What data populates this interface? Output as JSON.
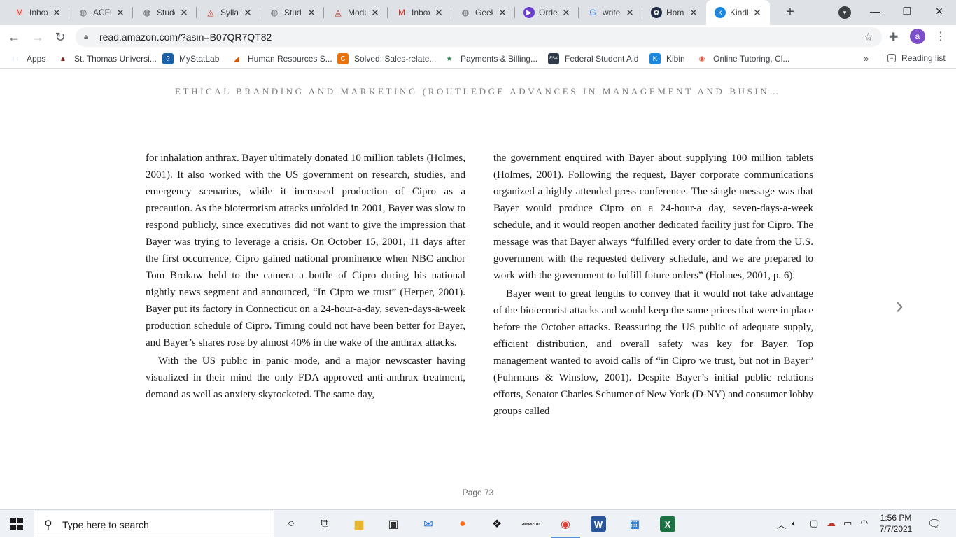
{
  "browser": {
    "tabs": [
      {
        "label": "Inbox",
        "icon": "gmail-icon",
        "glyph": "M",
        "color": "#d93025",
        "bg": "transparent"
      },
      {
        "label": "ACFr",
        "icon": "globe-icon",
        "glyph": "◍",
        "color": "#5f6368",
        "bg": "transparent"
      },
      {
        "label": "Stude",
        "icon": "globe-icon",
        "glyph": "◍",
        "color": "#5f6368",
        "bg": "transparent"
      },
      {
        "label": "Syllab",
        "icon": "canvas-icon",
        "glyph": "◬",
        "color": "#c0392b",
        "bg": "transparent"
      },
      {
        "label": "Stude",
        "icon": "globe-icon",
        "glyph": "◍",
        "color": "#5f6368",
        "bg": "transparent"
      },
      {
        "label": "Modu",
        "icon": "canvas-icon",
        "glyph": "◬",
        "color": "#c0392b",
        "bg": "transparent"
      },
      {
        "label": "Inbox",
        "icon": "gmail-icon",
        "glyph": "M",
        "color": "#d93025",
        "bg": "transparent"
      },
      {
        "label": "Geek",
        "icon": "globe-icon",
        "glyph": "◍",
        "color": "#5f6368",
        "bg": "transparent"
      },
      {
        "label": "Orde",
        "icon": "play-icon",
        "glyph": "▶",
        "color": "#ffffff",
        "bg": "#6a3fd0"
      },
      {
        "label": "write",
        "icon": "google-icon",
        "glyph": "G",
        "color": "#4285f4",
        "bg": "transparent"
      },
      {
        "label": "Hom",
        "icon": "hub-icon",
        "glyph": "✿",
        "color": "#ffffff",
        "bg": "#1f2a44"
      },
      {
        "label": "Kindl",
        "icon": "kindle-icon",
        "glyph": "k",
        "color": "#ffffff",
        "bg": "#1a88e0"
      }
    ],
    "active_tab_index": 11,
    "url": "read.amazon.com/?asin=B07QR7QT82",
    "bookmarks": [
      {
        "label": "Apps",
        "icon": "apps-grid-icon",
        "glyph": "⋮⋮",
        "color": "#1a73e8",
        "bg": "transparent"
      },
      {
        "label": "St. Thomas Universi...",
        "icon": "st-thomas-icon",
        "glyph": "▲",
        "color": "#8b1a1a",
        "bg": "transparent"
      },
      {
        "label": "MyStatLab",
        "icon": "mystatlab-icon",
        "glyph": "?",
        "color": "#ffffff",
        "bg": "#1a5fa8"
      },
      {
        "label": "Human Resources S...",
        "icon": "chart-icon",
        "glyph": "◢",
        "color": "#d35400",
        "bg": "transparent"
      },
      {
        "label": "Solved: Sales-relate...",
        "icon": "chegg-icon",
        "glyph": "C",
        "color": "#ffffff",
        "bg": "#e8710a"
      },
      {
        "label": "Payments & Billing...",
        "icon": "star-icon",
        "glyph": "★",
        "color": "#2e8b57",
        "bg": "transparent"
      },
      {
        "label": "Federal Student Aid",
        "icon": "fsa-icon",
        "glyph": "FSA",
        "color": "#ffffff",
        "bg": "#2f3b4a"
      },
      {
        "label": "Kibin",
        "icon": "kibin-icon",
        "glyph": "K",
        "color": "#ffffff",
        "bg": "#1a88e0"
      },
      {
        "label": "Online Tutoring, Cl...",
        "icon": "tutoring-icon",
        "glyph": "◉",
        "color": "#e0533d",
        "bg": "transparent"
      }
    ],
    "more_label": "»",
    "reading_list_label": "Reading list"
  },
  "reader": {
    "book_title": "ETHICAL BRANDING AND MARKETING (ROUTLEDGE ADVANCES IN MANAGEMENT AND BUSIN…",
    "left_column": [
      {
        "indent": false,
        "text": "for inhalation anthrax. Bayer ultimately donated 10 million tablets (Holmes, 2001). It also worked with the US government on research, studies, and emergency scenarios, while it increased production of Cipro as a precaution. As the bioterrorism attacks unfolded in 2001, Bayer was slow to respond publicly, since executives did not want to give the impression that Bayer was trying to leverage a crisis. On October 15, 2001, 11 days after the first occurrence, Cipro gained national prominence when NBC anchor Tom Brokaw held to the camera a bottle of Cipro during his national nightly news segment and announced, “In Cipro we trust” (Herper, 2001). Bayer put its factory in Connecticut on a 24-hour-a-day, seven-days-a-week production schedule of Cipro. Timing could not have been better for Bayer, and Bayer’s shares rose by almost 40% in the wake of the anthrax attacks."
      },
      {
        "indent": true,
        "text": "With the US public in panic mode, and a major newscaster having visualized in their mind the only FDA approved anti-anthrax treatment, demand as well as anxiety skyrocketed. The same day,"
      }
    ],
    "right_column": [
      {
        "indent": false,
        "text": "the government enquired with Bayer about supplying 100 million tablets (Holmes, 2001). Following the request, Bayer corporate communications organized a highly attended press conference. The single message was that Bayer would produce Cipro on a 24-hour-a day, seven-days-a-week schedule, and it would reopen another dedicated facility just for Cipro. The message was that Bayer always “fulfilled every order to date from the U.S. government with the requested delivery schedule, and we are prepared to work with the government to fulfill future orders” (Holmes, 2001, p. 6)."
      },
      {
        "indent": true,
        "text": "Bayer went to great lengths to convey that it would not take advantage of the bioterrorist attacks and would keep the same prices that were in place before the October attacks. Reassuring the US public of adequate supply, efficient distribution, and overall safety was key for Bayer. Top management wanted to avoid calls of “in Cipro we trust, but not in Bayer” (Fuhrmans & Winslow, 2001). Despite Bayer’s initial public relations efforts, Senator Charles Schumer of New York (D-NY) and consumer lobby groups called"
      }
    ],
    "page_label": "Page 73",
    "next_arrow": "›"
  },
  "taskbar": {
    "search_placeholder": "Type here to search",
    "apps": [
      {
        "name": "cortana-icon",
        "glyph": "○",
        "color": "#1a1a1a",
        "bg": "transparent",
        "running": false
      },
      {
        "name": "task-view-icon",
        "glyph": "⧉",
        "color": "#1a1a1a",
        "bg": "transparent",
        "running": false
      },
      {
        "name": "file-explorer-icon",
        "glyph": "▆",
        "color": "#e8b730",
        "bg": "transparent",
        "running": false
      },
      {
        "name": "store-icon",
        "glyph": "▣",
        "color": "#333333",
        "bg": "transparent",
        "running": false
      },
      {
        "name": "mail-icon",
        "glyph": "✉",
        "color": "#0a64c8",
        "bg": "transparent",
        "running": false
      },
      {
        "name": "firefox-icon",
        "glyph": "●",
        "color": "#ff6f1a",
        "bg": "transparent",
        "running": false
      },
      {
        "name": "dropbox-icon",
        "glyph": "❖",
        "color": "#1a1a1a",
        "bg": "transparent",
        "running": false
      },
      {
        "name": "amazon-icon",
        "glyph": "amazon",
        "color": "#1a1a1a",
        "bg": "transparent",
        "running": false
      },
      {
        "name": "chrome-icon",
        "glyph": "◉",
        "color": "#db4437",
        "bg": "transparent",
        "running": true
      },
      {
        "name": "word-icon",
        "glyph": "W",
        "color": "#ffffff",
        "bg": "#2b579a",
        "running": false
      },
      {
        "name": "control-panel-icon",
        "glyph": "▦",
        "color": "#2b7cd3",
        "bg": "transparent",
        "running": false
      },
      {
        "name": "excel-icon",
        "glyph": "X",
        "color": "#ffffff",
        "bg": "#1e7145",
        "running": false
      }
    ],
    "time": "1:56 PM",
    "date": "7/7/2021"
  }
}
